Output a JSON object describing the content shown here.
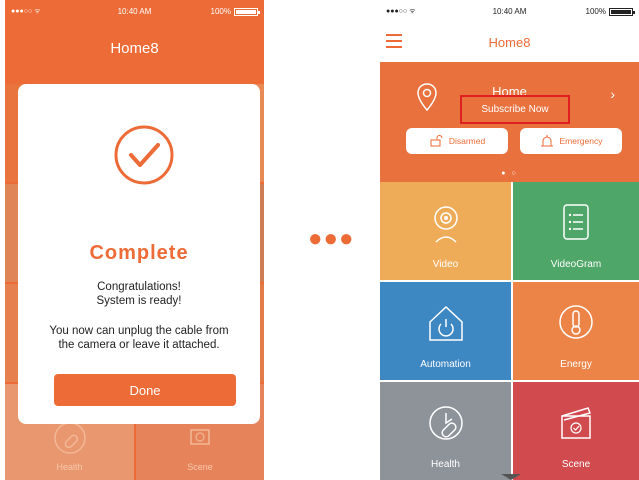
{
  "left_phone": {
    "status": {
      "signal": "●●●○○ ᯤ",
      "time": "10:40 AM",
      "battery": "100%"
    },
    "title": "Home8",
    "background_tiles": {
      "health": "Health",
      "scene": "Scene"
    },
    "modal": {
      "title": "Complete",
      "message_line1": "Congratulations!",
      "message_line2": "System is ready!",
      "detail_line1": "You now can unplug the cable from",
      "detail_line2": "the camera or leave it attached.",
      "done_label": "Done"
    }
  },
  "separator": "●●●",
  "right_phone": {
    "status": {
      "signal": "●●●○○ ᯤ",
      "time": "10:40 AM",
      "battery": "100%"
    },
    "nav": {
      "title": "Home8",
      "menu_icon": "hamburger-icon"
    },
    "hero": {
      "title": "Home",
      "subscribe_label": "Subscribe Now",
      "disarmed_label": "Disarmed",
      "emergency_label": "Emergency",
      "pager": "● ○"
    },
    "tiles": {
      "video": "Video",
      "videogram": "VideoGram",
      "automation": "Automation",
      "energy": "Energy",
      "health": "Health",
      "scene": "Scene"
    }
  },
  "colors": {
    "brand_orange": "#ec6b36",
    "video": "#efac58",
    "videogram": "#4ea668",
    "automation": "#3d87c2",
    "energy": "#ec8347",
    "health": "#8e9399",
    "scene": "#d14a4e",
    "highlight_box": "#e02020"
  }
}
